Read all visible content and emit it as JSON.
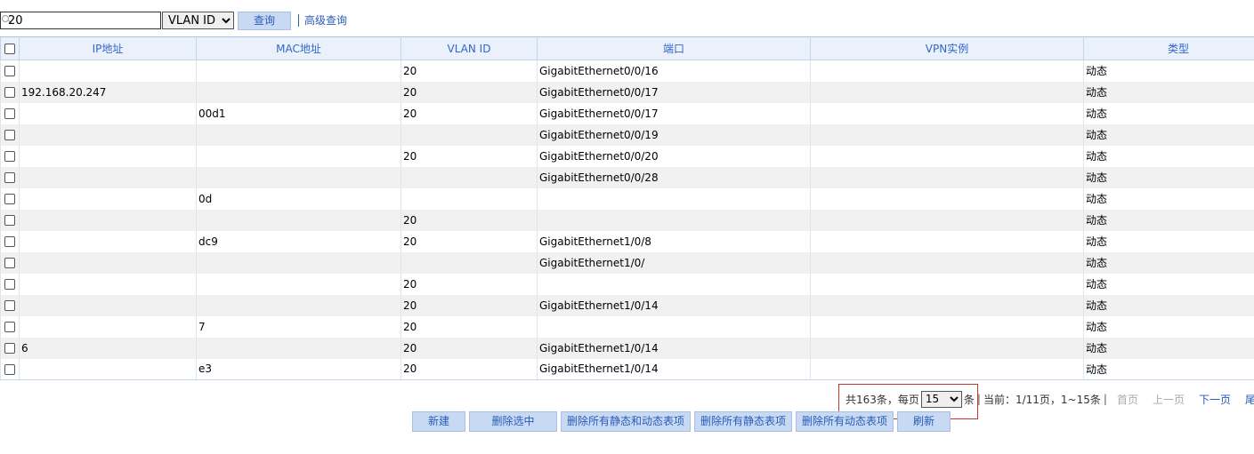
{
  "search": {
    "value": "20",
    "field_options": [
      "VLAN ID"
    ],
    "field_selected": "VLAN ID",
    "query_label": "查询",
    "advanced_label": "高级查询"
  },
  "table": {
    "headers": [
      "IP地址",
      "MAC地址",
      "VLAN ID",
      "端口",
      "VPN实例",
      "类型"
    ],
    "rows": [
      {
        "ip": "",
        "mac": "",
        "vlan": "20",
        "port": "GigabitEthernet0/0/16",
        "vpn": "",
        "type": "动态"
      },
      {
        "ip": "192.168.20.247",
        "mac": "",
        "vlan": "20",
        "port": "GigabitEthernet0/0/17",
        "vpn": "",
        "type": "动态"
      },
      {
        "ip": "",
        "mac": "00d1",
        "vlan": "20",
        "port": "GigabitEthernet0/0/17",
        "vpn": "",
        "type": "动态"
      },
      {
        "ip": "",
        "mac": "",
        "vlan": "",
        "port": "GigabitEthernet0/0/19",
        "vpn": "",
        "type": "动态"
      },
      {
        "ip": "",
        "mac": "",
        "vlan": "20",
        "port": "GigabitEthernet0/0/20",
        "vpn": "",
        "type": "动态"
      },
      {
        "ip": "",
        "mac": "",
        "vlan": "",
        "port": "GigabitEthernet0/0/28",
        "vpn": "",
        "type": "动态"
      },
      {
        "ip": "",
        "mac": "0d",
        "vlan": "",
        "port": "",
        "vpn": "",
        "type": "动态"
      },
      {
        "ip": "",
        "mac": "",
        "vlan": "20",
        "port": "",
        "vpn": "",
        "type": "动态"
      },
      {
        "ip": "",
        "mac": "dc9",
        "vlan": "20",
        "port": "GigabitEthernet1/0/8",
        "vpn": "",
        "type": "动态"
      },
      {
        "ip": "",
        "mac": "",
        "vlan": "",
        "port": "GigabitEthernet1/0/",
        "vpn": "",
        "type": "动态"
      },
      {
        "ip": "",
        "mac": "",
        "vlan": "20",
        "port": "",
        "vpn": "",
        "type": "动态"
      },
      {
        "ip": "",
        "mac": "",
        "vlan": "20",
        "port": "GigabitEthernet1/0/14",
        "vpn": "",
        "type": "动态"
      },
      {
        "ip": "",
        "mac": "7",
        "vlan": "20",
        "port": "",
        "vpn": "",
        "type": "动态"
      },
      {
        "ip": "6",
        "mac": "",
        "vlan": "20",
        "port": "GigabitEthernet1/0/14",
        "vpn": "",
        "type": "动态"
      },
      {
        "ip": "",
        "mac": "e3",
        "vlan": "20",
        "port": "GigabitEthernet1/0/14",
        "vpn": "",
        "type": "动态"
      }
    ]
  },
  "pager": {
    "total_prefix": "共163条，每页",
    "per_page": "15",
    "per_page_suffix": "条",
    "current": "当前：1/11页，1~15条",
    "first": "首页",
    "prev": "上一页",
    "next": "下一页",
    "last": "尾页",
    "page_value": "1"
  },
  "actions": {
    "new": "新建",
    "delete_selected": "删除选中",
    "delete_all": "删除所有静态和动态表项",
    "delete_static": "删除所有静态表项",
    "delete_dynamic": "删除所有动态表项",
    "refresh": "刷新"
  }
}
